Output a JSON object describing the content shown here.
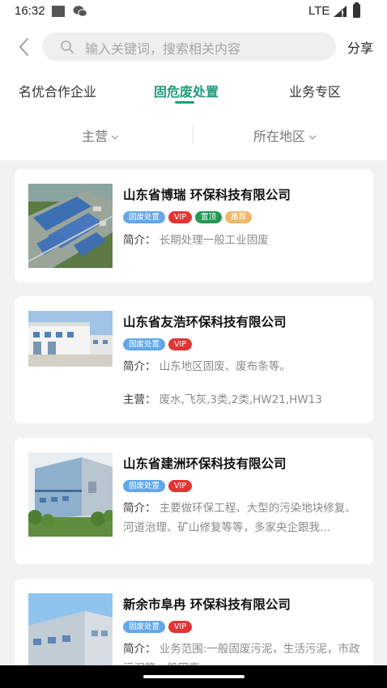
{
  "status_bar": {
    "time": "16:32",
    "network": "LTE"
  },
  "header": {
    "search_placeholder": "输入关键词，搜索相关内容",
    "share_label": "分享"
  },
  "tabs": [
    {
      "label": "名优合作企业",
      "active": false
    },
    {
      "label": "固危废处置",
      "active": true
    },
    {
      "label": "业务专区",
      "active": false
    }
  ],
  "filters": [
    {
      "label": "主营"
    },
    {
      "label": "所在地区"
    }
  ],
  "colors": {
    "accent": "#1f9a7c",
    "tag_blue": "#63a7e8",
    "tag_red": "#e03535",
    "tag_green": "#1f9a55",
    "tag_orange": "#f0b866"
  },
  "companies": [
    {
      "name": "山东省博瑞 环保科技有限公司",
      "tags": [
        "固废处置",
        "VIP",
        "置顶",
        "推荐"
      ],
      "intro_label": "简介：",
      "intro": "长期处理一般工业固废",
      "thumbnail": "aerial-factory"
    },
    {
      "name": "山东省友浩环保科技有限公司",
      "tags": [
        "固废处置",
        "VIP"
      ],
      "intro_label": "简介：",
      "intro": "山东地区固废、废布条等。",
      "main_label": "主营：",
      "main": "废水,飞灰,3类,2类,HW21,HW13",
      "thumbnail": "white-warehouse"
    },
    {
      "name": "山东省建洲环保科技有限公司",
      "tags": [
        "固废处置",
        "VIP"
      ],
      "intro_label": "简介：",
      "intro": "主要做环保工程、大型的污染地块修复、河道治理、矿山修复等等，多家央企跟我…",
      "thumbnail": "steel-building"
    },
    {
      "name": "新余市阜冉 环保科技有限公司",
      "tags": [
        "固废处置",
        "VIP"
      ],
      "intro_label": "简介：",
      "intro": "业务范围:一般固废污泥，生活污泥，市政污泥等一般固废",
      "thumbnail": "gray-warehouse"
    }
  ]
}
